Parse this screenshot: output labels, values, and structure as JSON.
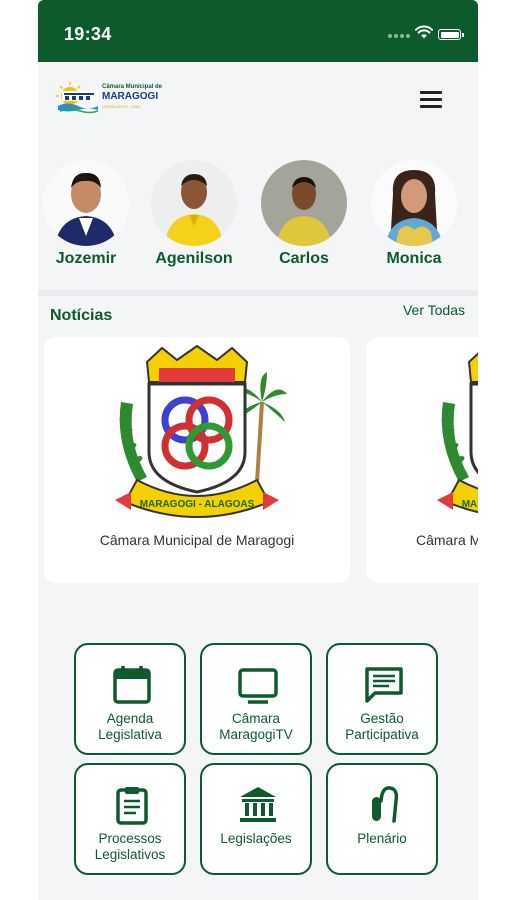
{
  "status": {
    "time": "19:34"
  },
  "header": {
    "logo": {
      "line1": "Câmara Municipal de",
      "line2": "MARAGOGI",
      "line3": "LEGISLATIVO - 2021"
    },
    "menu_icon": "hamburger-menu-icon"
  },
  "councilors": [
    {
      "name": "Jozemir"
    },
    {
      "name": "Agenilson"
    },
    {
      "name": "Carlos"
    },
    {
      "name": "Monica"
    }
  ],
  "news": {
    "title": "Notícias",
    "see_all": "Ver Todas",
    "items": [
      {
        "caption": "Câmara Municipal de Maragogi",
        "crest_text": "MARAGOGI - ALAGOAS"
      },
      {
        "caption": "Câmara Municipal de Maragogi",
        "crest_text": "MARAGOGI - ALAGOAS"
      }
    ]
  },
  "menu": [
    {
      "line1": "Agenda",
      "line2": "Legislativa",
      "icon": "calendar-icon"
    },
    {
      "line1": "Câmara",
      "line2": "MaragogiTV",
      "icon": "tv-icon"
    },
    {
      "line1": "Gestão",
      "line2": "Participativa",
      "icon": "chat-icon"
    },
    {
      "line1": "Processos",
      "line2": "Legislativos",
      "icon": "clipboard-icon"
    },
    {
      "line1": "Legislações",
      "line2": "",
      "icon": "institution-icon"
    },
    {
      "line1": "Plenário",
      "line2": "",
      "icon": "microphone-icon"
    }
  ],
  "colors": {
    "primary": "#0d5a2c",
    "background": "#f4f5f7"
  }
}
